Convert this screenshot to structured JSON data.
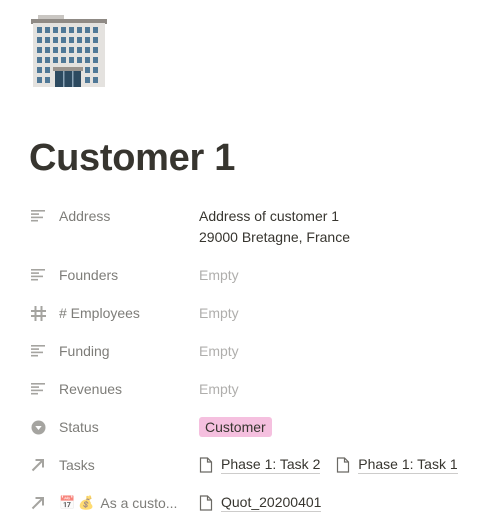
{
  "page": {
    "icon": "office-building-emoji",
    "title": "Customer 1"
  },
  "properties": [
    {
      "name": "Address",
      "icon": "text-lines-icon",
      "value_lines": [
        "Address of customer 1",
        "29000 Bretagne, France"
      ]
    },
    {
      "name": "Founders",
      "icon": "text-lines-icon",
      "value": "Empty"
    },
    {
      "name": "# Employees",
      "icon": "hash-icon",
      "value": "Empty"
    },
    {
      "name": "Funding",
      "icon": "text-lines-icon",
      "value": "Empty"
    },
    {
      "name": "Revenues",
      "icon": "text-lines-icon",
      "value": "Empty"
    },
    {
      "name": "Status",
      "icon": "select-icon",
      "value": "Customer",
      "tag_color": "#f5c0df"
    },
    {
      "name": "Tasks",
      "icon": "relation-arrow-icon",
      "relations": [
        "Phase 1: Task 2",
        "Phase 1: Task 1"
      ]
    },
    {
      "name": "As a custo...",
      "icon": "relation-arrow-icon",
      "emojis": [
        "📅",
        "💰"
      ],
      "relations": [
        "Quot_20200401"
      ]
    }
  ]
}
